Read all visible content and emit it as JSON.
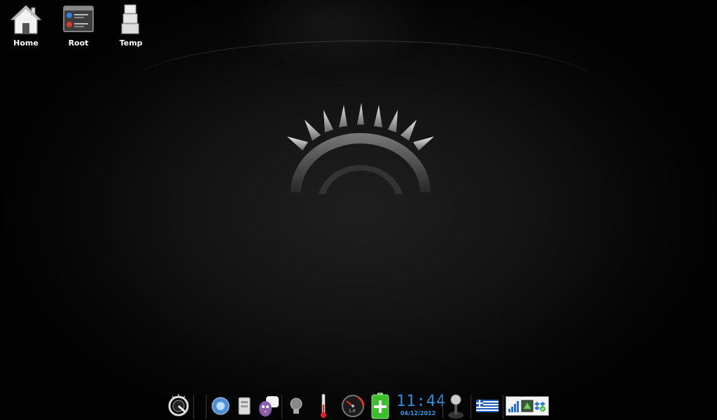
{
  "desktop": {
    "icons": [
      {
        "label": "Home",
        "icon": "home-icon"
      },
      {
        "label": "Root",
        "icon": "root-window-icon"
      },
      {
        "label": "Temp",
        "icon": "temp-boxes-icon"
      }
    ]
  },
  "taskbar": {
    "clock": {
      "time": "11:44",
      "date": "04/12/2012"
    },
    "speedometer_label": "1.0",
    "items": [
      "menu-logo-icon",
      "browser-icon",
      "file-manager-icon",
      "chat-icon",
      "lightbulb-icon",
      "thermometer-icon",
      "speedometer-icon",
      "battery-icon",
      "clock",
      "joystick-icon",
      "greece-flag-icon",
      "network-signal-icon",
      "update-icon",
      "dropbox-icon"
    ]
  },
  "colors": {
    "clock": "#2f8fe0",
    "battery": "#3bbf2a",
    "background": "#0a0a0a"
  }
}
